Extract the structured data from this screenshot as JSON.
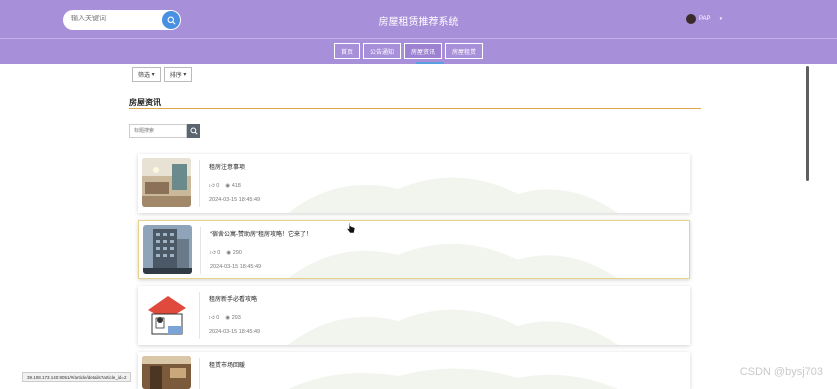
{
  "header": {
    "search_placeholder": "输入关键词",
    "site_title": "房屋租赁推荐系统",
    "user_name": "PAP"
  },
  "nav": {
    "items": [
      {
        "label": "首页"
      },
      {
        "label": "公告通知"
      },
      {
        "label": "房屋资讯"
      },
      {
        "label": "房屋租赁"
      }
    ],
    "active_index": 2
  },
  "filters": {
    "filter_label": "筛选",
    "sort_label": "排序"
  },
  "section": {
    "title": "房屋资讯",
    "search_placeholder": "标题搜索"
  },
  "articles": [
    {
      "title": "租房注意事项",
      "likes": "0",
      "views": "418",
      "date": "2024-03-15 18:45:49"
    },
    {
      "title": "“宿舍公寓-赞助房”租房攻略！它来了！",
      "likes": "0",
      "views": "290",
      "date": "2024-03-15 18:45:49"
    },
    {
      "title": "租房新手必看攻略",
      "likes": "0",
      "views": "293",
      "date": "2024-03-15 18:45:49"
    },
    {
      "title": "租赁市场回暖",
      "likes": "",
      "views": "",
      "date": ""
    }
  ],
  "status_bar": {
    "url": "39.108.173.140:8051/#/article/details?article_id=2"
  },
  "watermark": "CSDN @bysj703",
  "colors": {
    "header_bg": "#a88fd9",
    "accent_line": "#e2a54a",
    "search_button": "#4a90e2"
  }
}
